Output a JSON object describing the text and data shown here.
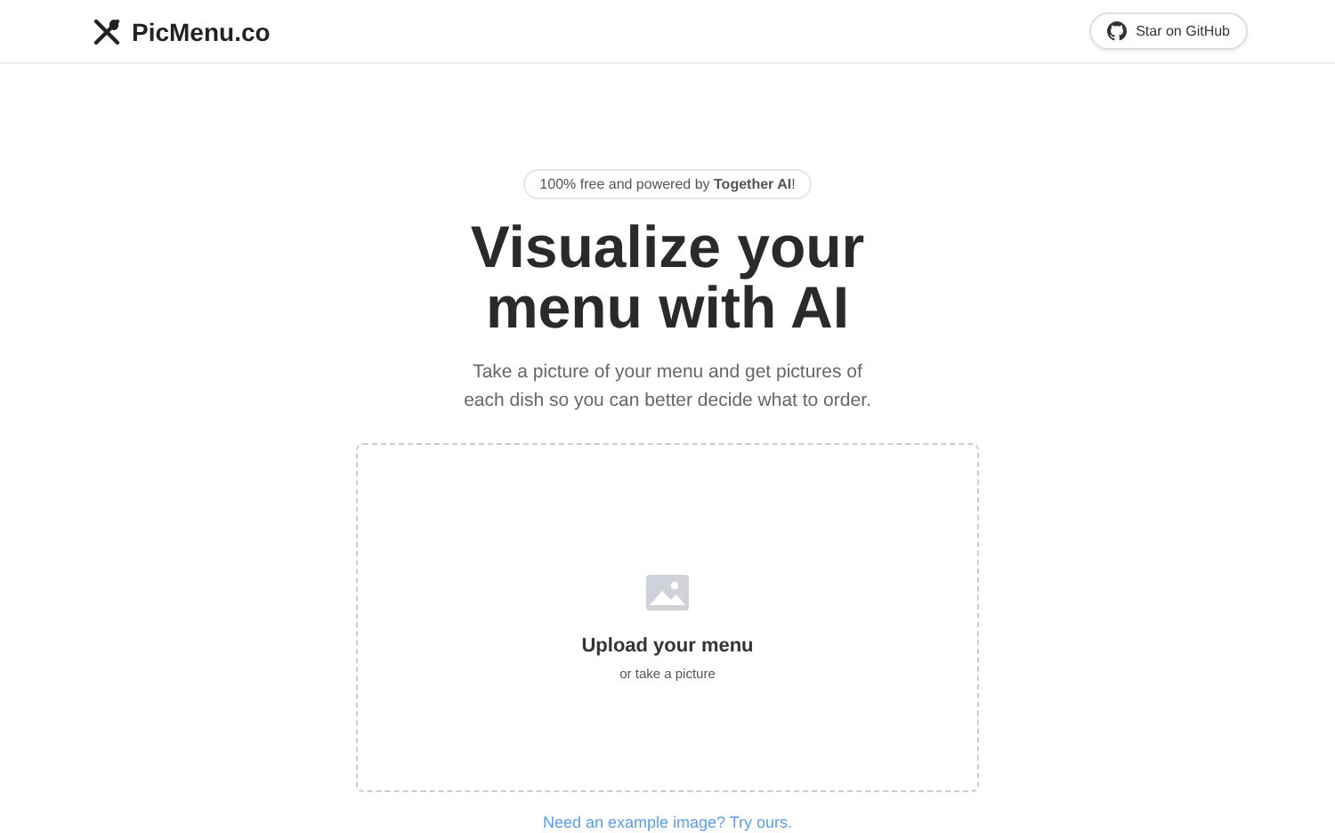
{
  "header": {
    "logo": "PicMenu.co",
    "github_button": "Star on GitHub"
  },
  "badge": "100% free and powered by **Together AI**!",
  "title": "Visualize your menu with AI",
  "subtitle": "Take a picture of your menu and get pictures of each dish so you can better decide what to order.",
  "upload": {
    "title": "Upload your menu",
    "hint": "or take a picture"
  },
  "example_link": "Need an example image? Try ours."
}
